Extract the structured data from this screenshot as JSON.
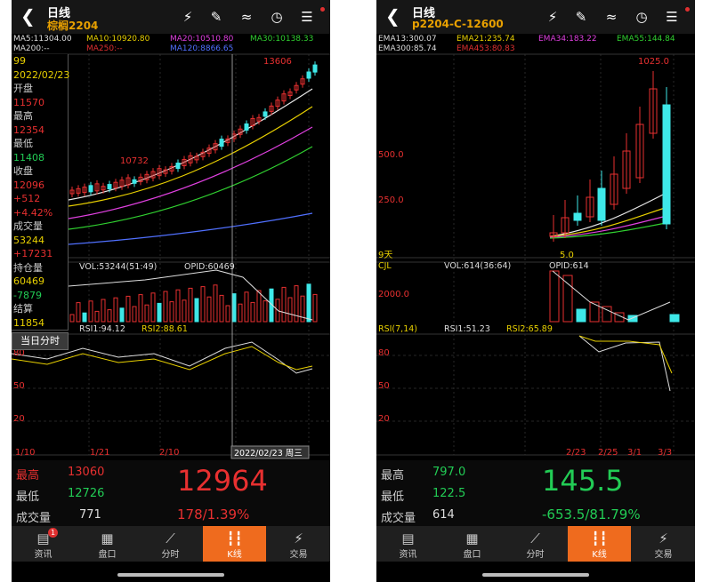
{
  "left": {
    "title": "日线",
    "symbol": "棕榈2204",
    "ma_line1": [
      "MA5:11304.00",
      "MA10:10920.80",
      "MA20:10510.80",
      "MA30:10138.33"
    ],
    "ma_line2": [
      "MA200:--",
      "MA250:--",
      "MA120:8866.65"
    ],
    "info_panel": [
      "99",
      "2022/02/23",
      "开盘",
      "11570",
      "最高",
      "12354",
      "最低",
      "11408",
      "收盘",
      "12096",
      "+512",
      "+4.42%",
      "成交量",
      "53244",
      "+17231",
      "持仓量",
      "60469",
      "-7879",
      "结算",
      "11854"
    ],
    "current_day_button": "当日分时",
    "price_labels": [
      "13606",
      "10732"
    ],
    "vol_labels": [
      "VOL:53244(51:49)",
      "OPID:60469"
    ],
    "rsi_labels": [
      "RSI1:94.12",
      "RSI2:88.61"
    ],
    "rsi_axis": [
      "80",
      "50",
      "20"
    ],
    "date_labels": [
      "1/10",
      "1/21",
      "2/10"
    ],
    "crosshair_date": "2022/02/23 周三",
    "stats": {
      "high_label": "最高",
      "high": "13060",
      "low_label": "最低",
      "low": "12726",
      "vol_label": "成交量",
      "vol": "771"
    },
    "last_price": "12964",
    "change": "178/1.39%",
    "price_color": "#e83030"
  },
  "right": {
    "title": "日线",
    "symbol": "p2204-C-12600",
    "ema_line1": [
      "EMA13:300.07",
      "EMA21:235.74",
      "EMA34:183.22",
      "EMA55:144.84"
    ],
    "ema_line2": [
      "EMA300:85.74",
      "EMA453:80.83"
    ],
    "price_axis": [
      "500.0",
      "250.0"
    ],
    "price_labels": [
      "1025.0",
      "5.0"
    ],
    "days_label": "9天",
    "sub_labels": [
      "CJL",
      "VOL:614(36:64)",
      "OPID:614"
    ],
    "vol_axis": "2000.0",
    "rsi_labels": [
      "RSI(7,14)",
      "RSI1:51.23",
      "RSI2:65.89"
    ],
    "rsi_axis": [
      "80",
      "50",
      "20"
    ],
    "date_labels": [
      "2/23",
      "2/25",
      "3/1",
      "3/3"
    ],
    "stats": {
      "high_label": "最高",
      "high": "797.0",
      "low_label": "最低",
      "low": "122.5",
      "vol_label": "成交量",
      "vol": "614"
    },
    "last_price": "145.5",
    "change": "-653.5/81.79%",
    "price_color": "#22cc55"
  },
  "nav": {
    "tabs": [
      "资讯",
      "盘口",
      "分时",
      "K线",
      "交易"
    ],
    "badge": "1",
    "active": "K线",
    "icons": [
      "news-icon",
      "orderbook-icon",
      "timeshare-icon",
      "kline-icon",
      "trade-icon"
    ]
  },
  "colors": {
    "up": "#e83030",
    "down": "#3ee8e8",
    "accent": "#ef6b1e"
  }
}
